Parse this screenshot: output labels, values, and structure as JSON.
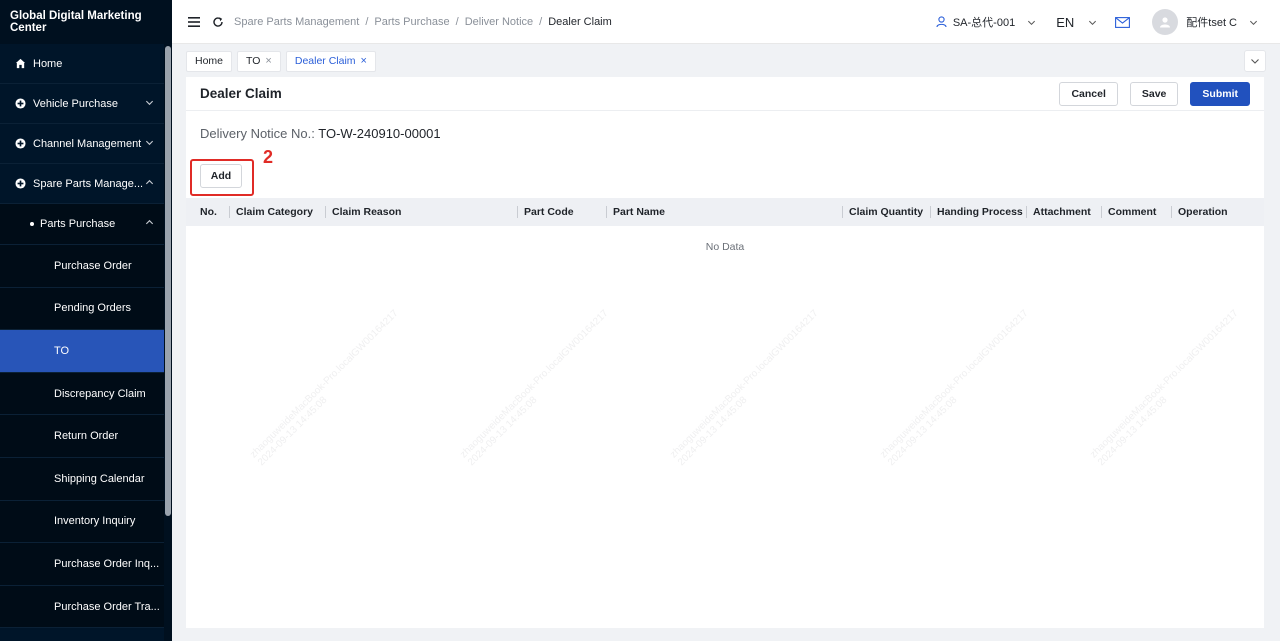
{
  "sidebar": {
    "brand": "Global Digital Marketing Center",
    "items": [
      {
        "label": "Home"
      },
      {
        "label": "Vehicle Purchase"
      },
      {
        "label": "Channel Management"
      },
      {
        "label": "Spare Parts Manage..."
      }
    ],
    "submenu": {
      "label": "Parts Purchase"
    },
    "leaves": [
      {
        "label": "Purchase Order"
      },
      {
        "label": "Pending Orders"
      },
      {
        "label": "TO"
      },
      {
        "label": "Discrepancy Claim"
      },
      {
        "label": "Return Order"
      },
      {
        "label": "Shipping Calendar"
      },
      {
        "label": "Inventory Inquiry"
      },
      {
        "label": "Purchase Order Inq..."
      },
      {
        "label": "Purchase Order Tra..."
      }
    ]
  },
  "header": {
    "breadcrumb": [
      "Spare Parts Management",
      "Parts Purchase",
      "Deliver Notice",
      "Dealer Claim"
    ],
    "store": "SA-总代-001",
    "language": "EN",
    "user": "配件tset C"
  },
  "tabs": [
    {
      "label": "Home"
    },
    {
      "label": "TO"
    },
    {
      "label": "Dealer Claim"
    }
  ],
  "page": {
    "title": "Dealer Claim",
    "cancel_label": "Cancel",
    "save_label": "Save",
    "submit_label": "Submit",
    "notice_label": "Delivery Notice No.:",
    "notice_value": "TO-W-240910-00001",
    "annotation_number": "2",
    "add_label": "Add",
    "columns": [
      "No.",
      "Claim Category",
      "Claim Reason",
      "Part Code",
      "Part Name",
      "Claim Quantity",
      "Handing Process",
      "Attachment",
      "Comment",
      "Operation"
    ],
    "empty_text": "No Data"
  },
  "watermark": {
    "line1": "zhaoguweideMacBook-Pro.localGW00164217",
    "line2": "2024-09-13 14:45:08"
  },
  "colors": {
    "sidebar_bg": "#001529",
    "active_item": "#2855b8",
    "primary": "#2151be",
    "annotation": "#e02b26"
  }
}
